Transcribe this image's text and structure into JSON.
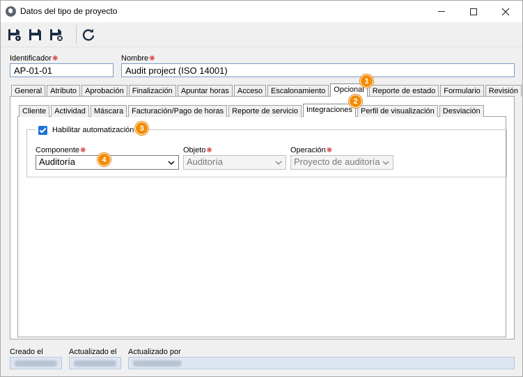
{
  "window": {
    "title": "Datos del tipo de proyecto"
  },
  "toolbar": {
    "icons": [
      "save-new-icon",
      "save-icon",
      "save-close-icon",
      "refresh-icon"
    ]
  },
  "form": {
    "id_label": "Identificador",
    "id_value": "AP-01-01",
    "name_label": "Nombre",
    "name_value": "Audit project (ISO 14001)"
  },
  "main_tabs": [
    "General",
    "Atributo",
    "Aprobación",
    "Finalización",
    "Apuntar horas",
    "Acceso",
    "Escalonamiento",
    "Opcional",
    "Reporte de estado",
    "Formulario",
    "Revisión"
  ],
  "main_tab_active": "Opcional",
  "sub_tabs": [
    "Cliente",
    "Actividad",
    "Máscara",
    "Facturación/Pago de horas",
    "Reporte de servicio",
    "Integraciones",
    "Perfil de visualización",
    "Desviación"
  ],
  "sub_tab_active": "Integraciones",
  "automation": {
    "checkbox_label": "Habilitar automatización",
    "checked": true,
    "component_label": "Componente",
    "component_value": "Auditoría",
    "object_label": "Objeto",
    "object_value": "Auditoría",
    "operation_label": "Operación",
    "operation_value": "Proyecto de auditoría"
  },
  "callouts": [
    "1",
    "2",
    "3",
    "4"
  ],
  "footer": {
    "created_label": "Creado el",
    "updated_label": "Actualizado el",
    "updated_by_label": "Actualizado por"
  },
  "colors": {
    "accent": "#1a73d9",
    "callout": "#f28c00",
    "required": "#d42020"
  }
}
